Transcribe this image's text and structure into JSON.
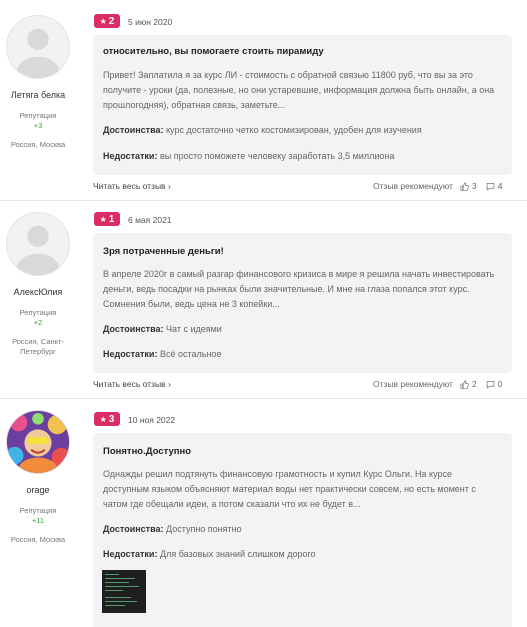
{
  "reviews": [
    {
      "rating": "2",
      "date": "5 июн 2020",
      "author": "Летяга белка",
      "rep_label": "Репутация",
      "rep_value": "+3",
      "city": "Россия, Москва",
      "title": "относительно, вы помогаете стоить пирамиду",
      "body": "Привет! Заплатила я за курс ЛИ - стоимость с обратной связью 11800 руб, что вы за это получите - уроки (да, полезные, но они устаревшие, информация должна быть онлайн, а она прошлогодняя), обратная связь, заметьте...",
      "pros_label": "Достоинства:",
      "pros": "курс достаточно четко костомизирован, удобен для изучения",
      "cons_label": "Недостатки:",
      "cons": "вы просто поможете человеку заработать 3,5 миллиона",
      "read_more": "Читать весь отзыв",
      "recommend_label": "Отзыв рекомендуют",
      "likes": "3",
      "comments": "4"
    },
    {
      "rating": "1",
      "date": "6 мая 2021",
      "author": "АлексЮлия",
      "rep_label": "Репутация",
      "rep_value": "+2",
      "city": "Россия, Санкт-Петербург",
      "title": "Зря потраченные деньги!",
      "body": "В апреле 2020г в самый разгар финансового кризиса в мире я решила начать инвестировать деньги, ведь посадки на рынках были значительные. И мне на глаза попался этот курс. Сомнения были, ведь цена не 3 копейки...",
      "pros_label": "Достоинства:",
      "pros": "Чат с идеями",
      "cons_label": "Недостатки:",
      "cons": "Всё остальное",
      "read_more": "Читать весь отзыв",
      "recommend_label": "Отзыв рекомендуют",
      "likes": "2",
      "comments": "0"
    },
    {
      "rating": "3",
      "date": "10 ноя 2022",
      "author": "orage",
      "rep_label": "Репутация",
      "rep_value": "+11",
      "city": "Россия, Москва",
      "title": "Понятно.Доступно",
      "body": "Однажды решил подтянуть финансовую грамотность и купил Курс Ольги. На курсе доступным языком объясняют материал воды нет практически совсем, но есть момент с чатом где обещали идеи, а потом сказали что их не будет в...",
      "pros_label": "Достоинства:",
      "pros": "Доступно понятно",
      "cons_label": "Недостатки:",
      "cons": "Для базовых знаний слишком дорого"
    }
  ],
  "colors": {
    "badge": "#d92d63",
    "reputation": "#36a02f",
    "card_bg": "#f3f3f3"
  },
  "icons": {
    "star": "star-icon",
    "chevron": "chevron-right-icon",
    "like": "thumb-up-icon",
    "comment": "comment-icon"
  }
}
